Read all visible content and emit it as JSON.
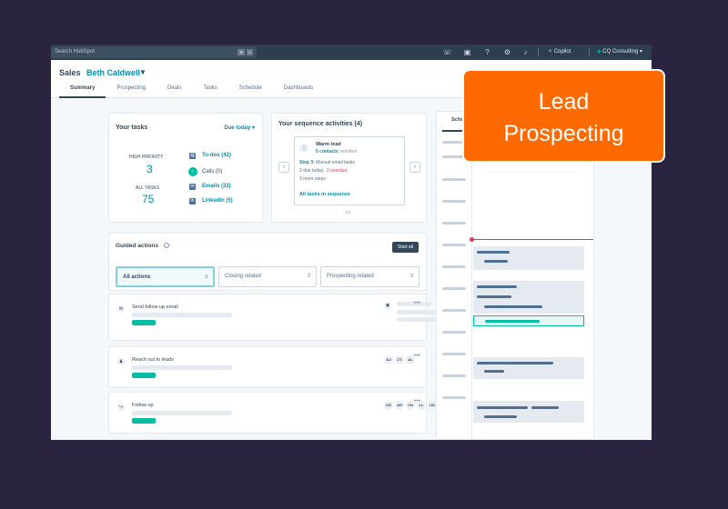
{
  "topbar": {
    "search_placeholder": "Search HubSpot",
    "shortcut_keys": [
      "⌘",
      "K"
    ],
    "copilot_label": "Copilot",
    "account_label": "CQ Consulting"
  },
  "header": {
    "app_title": "Sales",
    "owner_name": "Beth Caldwell",
    "tabs": [
      "Summary",
      "Prospecting",
      "Deals",
      "Tasks",
      "Schedule",
      "Dashboards"
    ]
  },
  "tasks_card": {
    "title": "Your tasks",
    "due_filter": "Due today ▾",
    "high_priority_label": "HIGH PRIORITY",
    "high_priority_value": "3",
    "all_tasks_label": "ALL TASKS",
    "all_tasks_value": "75",
    "items": [
      "To-dos (42)",
      "Calls (0)",
      "Emails (32)",
      "LinkedIn (5)"
    ]
  },
  "sequence_card": {
    "title": "Your sequence activities (4)",
    "sequence_name": "Warm lead",
    "contacts": "5 contacts",
    "enrolled": "enrolled",
    "step": "Step 3:",
    "step_desc": "Manual email tasks",
    "due_today": "2 due today,",
    "overdue": "2 overdue",
    "more_steps": "3 more steps",
    "all_tasks_link": "All tasks in sequence",
    "pager": "1/4"
  },
  "guided_actions": {
    "title": "Guided actions",
    "start_button": "Start all",
    "filters": [
      {
        "label": "All actions",
        "count": "3"
      },
      {
        "label": "Closing related",
        "count": "2"
      },
      {
        "label": "Prospecting related",
        "count": "2"
      }
    ],
    "rows": [
      {
        "label": "Send follow up email",
        "avatars": []
      },
      {
        "label": "Reach out to leads",
        "avatars": [
          "DJ",
          "ZT",
          "AL"
        ]
      },
      {
        "label": "Follow up",
        "avatars": [
          "OG",
          "AD",
          "CN",
          "LL",
          "UO"
        ]
      }
    ]
  },
  "schedule_panel": {
    "tab_label": "Sche"
  },
  "callout": {
    "line1": "Lead",
    "line2": "Prospecting"
  },
  "colors": {
    "background": "#2b2441",
    "accent_teal": "#00bda5",
    "link_blue": "#0091ae",
    "callout_orange": "#ff6a00",
    "nav_dark": "#2d3e50",
    "now_line": "#e0375b"
  }
}
